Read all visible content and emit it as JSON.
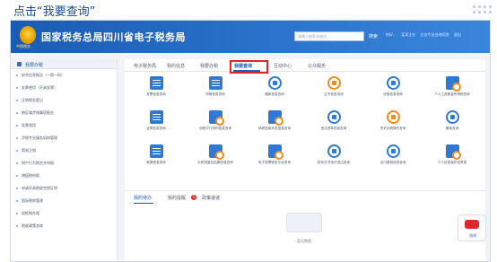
{
  "slide": {
    "title": "点击“我要查询”"
  },
  "app": {
    "emblem_text": "中国税务",
    "title": "国家税务总局四川省电子税务局",
    "search_placeholder": "请输入搜索关键词",
    "search_button": "搜索",
    "top_links": [
      "你好，",
      "某某企业",
      "企业专业咨询问答",
      "退出"
    ]
  },
  "sidebar": {
    "header": "我要办税",
    "items": [
      "综合信息报告（一照一码）",
      "发票使用（开具发票）",
      "注销税务登记",
      "跨区域涉税事项报告",
      "发票领用",
      "涉税专业服务机构管理",
      "简易注销",
      "财产行为税合并申报",
      "增值税申报",
      "申请开具税收完税证明",
      "国际税收管理",
      "退抵税办理",
      "税收政策咨询"
    ]
  },
  "tabs": {
    "items": [
      "电子税务局",
      "我的信息",
      "我要办税",
      "我要查询",
      "互动中心",
      "公众服务"
    ],
    "active": "我要查询"
  },
  "services": [
    {
      "label": "发票信息查询",
      "icon": "doc"
    },
    {
      "label": "申报信息查询",
      "icon": "doc"
    },
    {
      "label": "缴款信息查询",
      "icon": "circle"
    },
    {
      "label": "文书信息查询",
      "icon": "circle-orange"
    },
    {
      "label": "优惠信息查询",
      "icon": "circle"
    },
    {
      "label": "个人工资薪金所得税查询",
      "icon": "mag"
    },
    {
      "label": "证明信息查询",
      "icon": "doc"
    },
    {
      "label": "涉税中介机构信息查询",
      "icon": "mag"
    },
    {
      "label": "纳税信用状态信息查询",
      "icon": "mag"
    },
    {
      "label": "违法违章信息查询",
      "icon": "circle"
    },
    {
      "label": "历史办税操作查询",
      "icon": "circle-orange"
    },
    {
      "label": "备案查询",
      "icon": "circle"
    },
    {
      "label": "税源信息查询",
      "icon": "doc"
    },
    {
      "label": "办税进度及结果信息查询",
      "icon": "mag"
    },
    {
      "label": "电子发票服务平台查询",
      "icon": "mag"
    },
    {
      "label": "税务文书电子送达查询",
      "icon": "circle"
    },
    {
      "label": "出口退税信息查询",
      "icon": "circle"
    },
    {
      "label": "个人信息保护及举报",
      "icon": "mag"
    }
  ],
  "lower": {
    "tabs": [
      "我的待办",
      "我的提醒",
      "政策速递"
    ],
    "badge": "1",
    "empty_text": "暂无数据"
  },
  "float_badge": {
    "text": "咨询"
  }
}
